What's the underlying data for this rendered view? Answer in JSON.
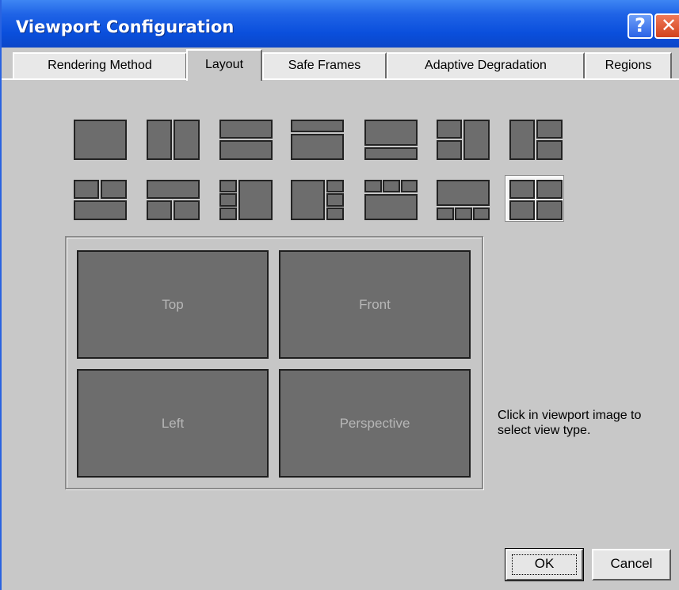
{
  "window": {
    "title": "Viewport Configuration"
  },
  "titlebar_buttons": {
    "help": "?",
    "close": "✕"
  },
  "tabs": [
    {
      "label": "Rendering Method",
      "active": false
    },
    {
      "label": "Layout",
      "active": true
    },
    {
      "label": "Safe Frames",
      "active": false
    },
    {
      "label": "Adaptive Degradation",
      "active": false
    },
    {
      "label": "Regions",
      "active": false
    }
  ],
  "layout_icons": {
    "row1": [
      "single",
      "two-vertical",
      "two-horizontal",
      "top-small-bottom-large",
      "top-large-bottom-small",
      "left-two-right-one",
      "left-one-right-two"
    ],
    "row2": [
      "top-two-bottom-one",
      "top-one-bottom-two",
      "left-three-right-one",
      "left-one-right-three",
      "top-three-bottom-one",
      "top-one-bottom-three",
      "quad"
    ],
    "selected": "quad"
  },
  "viewports": {
    "top_left": "Top",
    "top_right": "Front",
    "bottom_left": "Left",
    "bottom_right": "Perspective"
  },
  "hint": "Click in viewport image to select view type.",
  "buttons": {
    "ok": "OK",
    "cancel": "Cancel"
  },
  "colors": {
    "titlebar": "#0a4fdc",
    "panel": "#c8c8c8",
    "viewport": "#6d6d6d",
    "viewport_text": "#b7b7b7"
  }
}
